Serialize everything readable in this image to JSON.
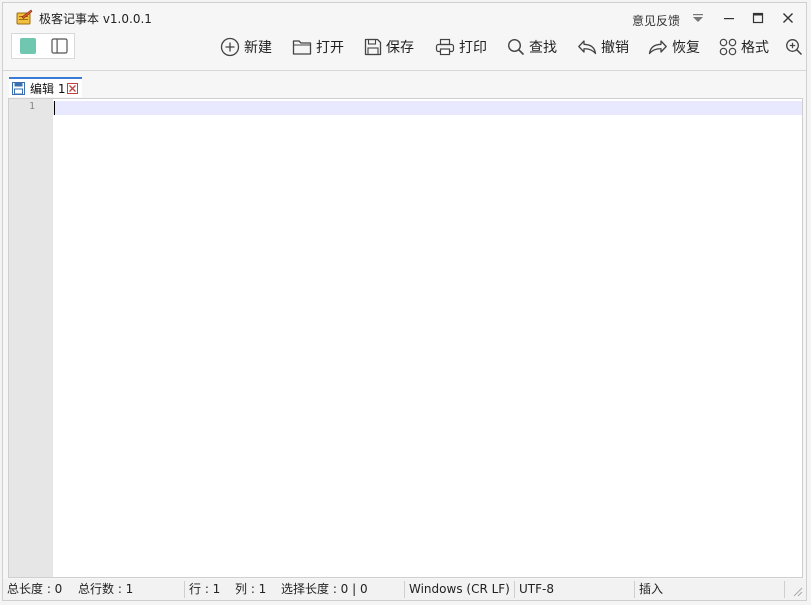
{
  "window": {
    "title": "极客记事本 v1.0.0.1",
    "feedback_label": "意见反馈"
  },
  "toolbar": {
    "items": [
      {
        "label": "新建",
        "icon": "plus-circle-icon"
      },
      {
        "label": "打开",
        "icon": "folder-icon"
      },
      {
        "label": "保存",
        "icon": "floppy-disk-icon"
      },
      {
        "label": "打印",
        "icon": "printer-icon"
      },
      {
        "label": "查找",
        "icon": "search-icon"
      },
      {
        "label": "撤销",
        "icon": "undo-icon"
      },
      {
        "label": "恢复",
        "icon": "redo-icon"
      },
      {
        "label": "格式",
        "icon": "grid-icon"
      }
    ],
    "accent_color": "#6fc7b0"
  },
  "tabs": [
    {
      "label": "编辑 1",
      "active": true
    }
  ],
  "editor": {
    "line_numbers": [
      "1"
    ],
    "content": ""
  },
  "statusbar": {
    "total_length": "总长度 : 0",
    "total_lines": "总行数 : 1",
    "row": "行 : 1",
    "col": "列 : 1",
    "selection": "选择长度 : 0 | 0",
    "line_ending": "Windows (CR LF)",
    "encoding": "UTF-8",
    "mode": "插入"
  }
}
